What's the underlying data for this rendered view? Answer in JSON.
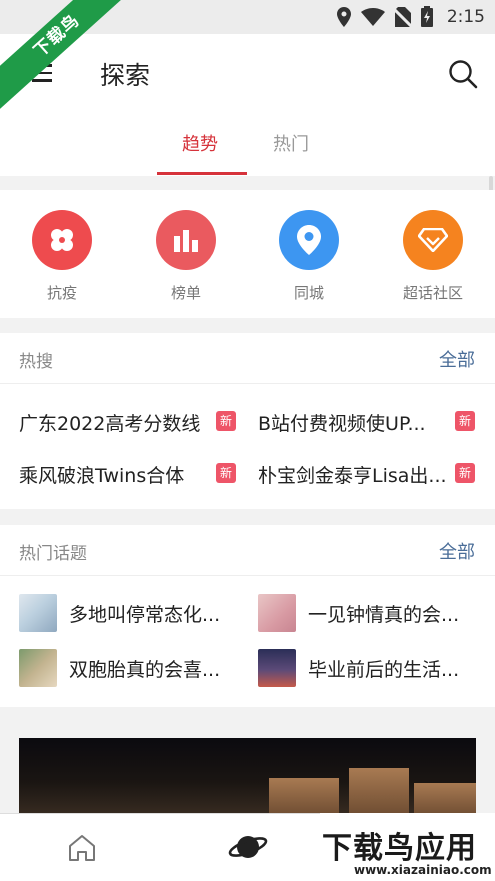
{
  "status_bar": {
    "time": "2:15"
  },
  "watermark": {
    "ribbon": "下载鸟",
    "main": "下载鸟应用",
    "site": "www.xiazainiao.com"
  },
  "header": {
    "title": "探索"
  },
  "tabs": [
    {
      "label": "趋势",
      "active": true
    },
    {
      "label": "热门",
      "active": false
    }
  ],
  "quick_entries": [
    {
      "label": "抗疫",
      "icon": "clover-icon",
      "color": "#ee4b4e"
    },
    {
      "label": "榜单",
      "icon": "bar-chart-icon",
      "color": "#ea5a5f"
    },
    {
      "label": "同城",
      "icon": "location-pin-icon",
      "color": "#3d96f1"
    },
    {
      "label": "超话社区",
      "icon": "diamond-icon",
      "color": "#f5831f"
    }
  ],
  "hot_search": {
    "title": "热搜",
    "more": "全部",
    "items": [
      {
        "text": "广东2022高考分数线",
        "badge": "新"
      },
      {
        "text": "B站付费视频使UP...",
        "badge": "新"
      },
      {
        "text": "乘风破浪Twins合体",
        "badge": "新"
      },
      {
        "text": "朴宝剑金泰亨Lisa出...",
        "badge": "新"
      }
    ]
  },
  "hot_topics": {
    "title": "热门话题",
    "more": "全部",
    "items": [
      {
        "text": "多地叫停常态化..."
      },
      {
        "text": "一见钟情真的会..."
      },
      {
        "text": "双胞胎真的会喜..."
      },
      {
        "text": "毕业前后的生活..."
      }
    ]
  },
  "bottom_nav": [
    {
      "icon": "home-icon"
    },
    {
      "icon": "planet-icon",
      "active": true
    }
  ],
  "colors": {
    "accent": "#d6333b",
    "link": "#4a6d98",
    "badge": "#ee5568"
  }
}
